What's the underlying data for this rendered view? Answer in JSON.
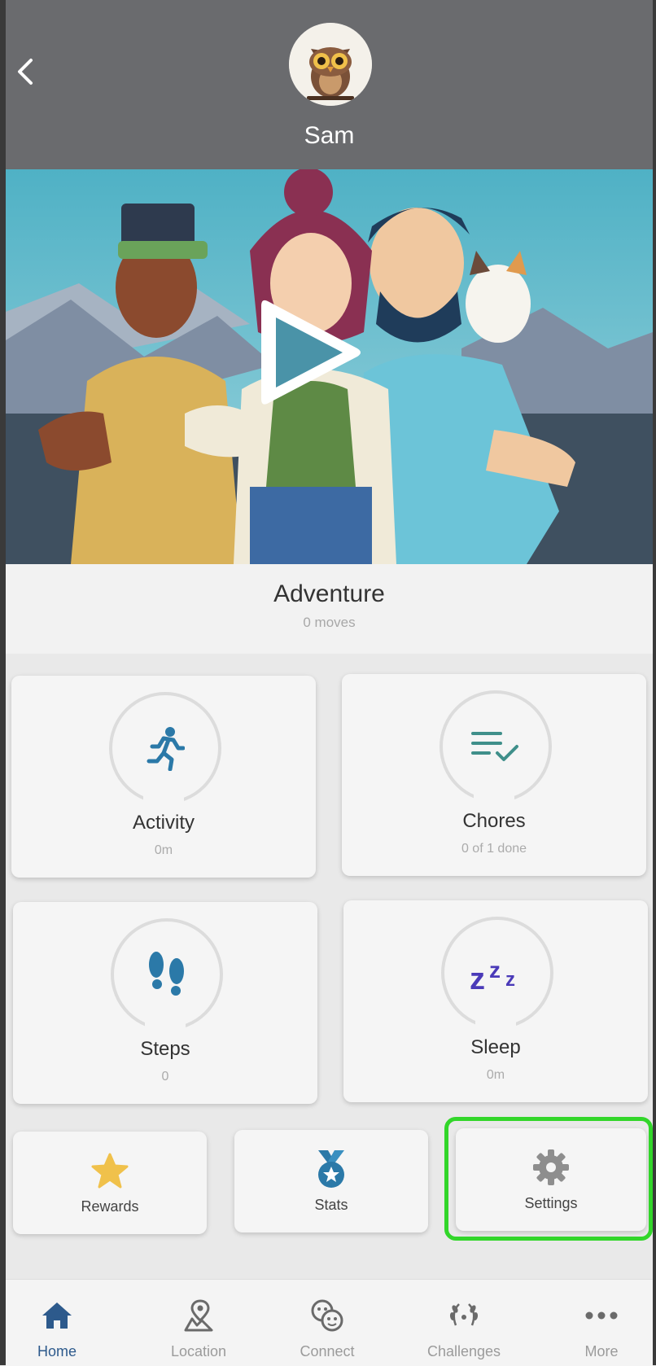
{
  "header": {
    "user_name": "Sam"
  },
  "hero": {
    "title": "Adventure",
    "subtitle": "0 moves"
  },
  "cards": [
    {
      "label": "Activity",
      "value": "0m",
      "icon": "running-icon"
    },
    {
      "label": "Chores",
      "value": "0 of 1 done",
      "icon": "checklist-icon"
    },
    {
      "label": "Steps",
      "value": "0",
      "icon": "footsteps-icon"
    },
    {
      "label": "Sleep",
      "value": "0m",
      "icon": "sleep-zzz-icon",
      "icon_text": "zzz"
    }
  ],
  "quick_actions": [
    {
      "label": "Rewards",
      "icon": "star-icon"
    },
    {
      "label": "Stats",
      "icon": "medal-icon"
    },
    {
      "label": "Settings",
      "icon": "gear-icon",
      "highlighted": true
    }
  ],
  "bottom_nav": [
    {
      "label": "Home",
      "icon": "home-icon",
      "active": true
    },
    {
      "label": "Location",
      "icon": "map-pin-icon"
    },
    {
      "label": "Connect",
      "icon": "chat-faces-icon"
    },
    {
      "label": "Challenges",
      "icon": "laurel-icon"
    },
    {
      "label": "More",
      "icon": "more-dots-icon"
    }
  ],
  "colors": {
    "header_bg": "#6a6b6e",
    "accent_blue": "#2b79a8",
    "active_nav": "#2d5a8c",
    "highlight_green": "#32d62a",
    "star_yellow": "#f0c14b",
    "sleep_purple": "#4a3ab8"
  }
}
